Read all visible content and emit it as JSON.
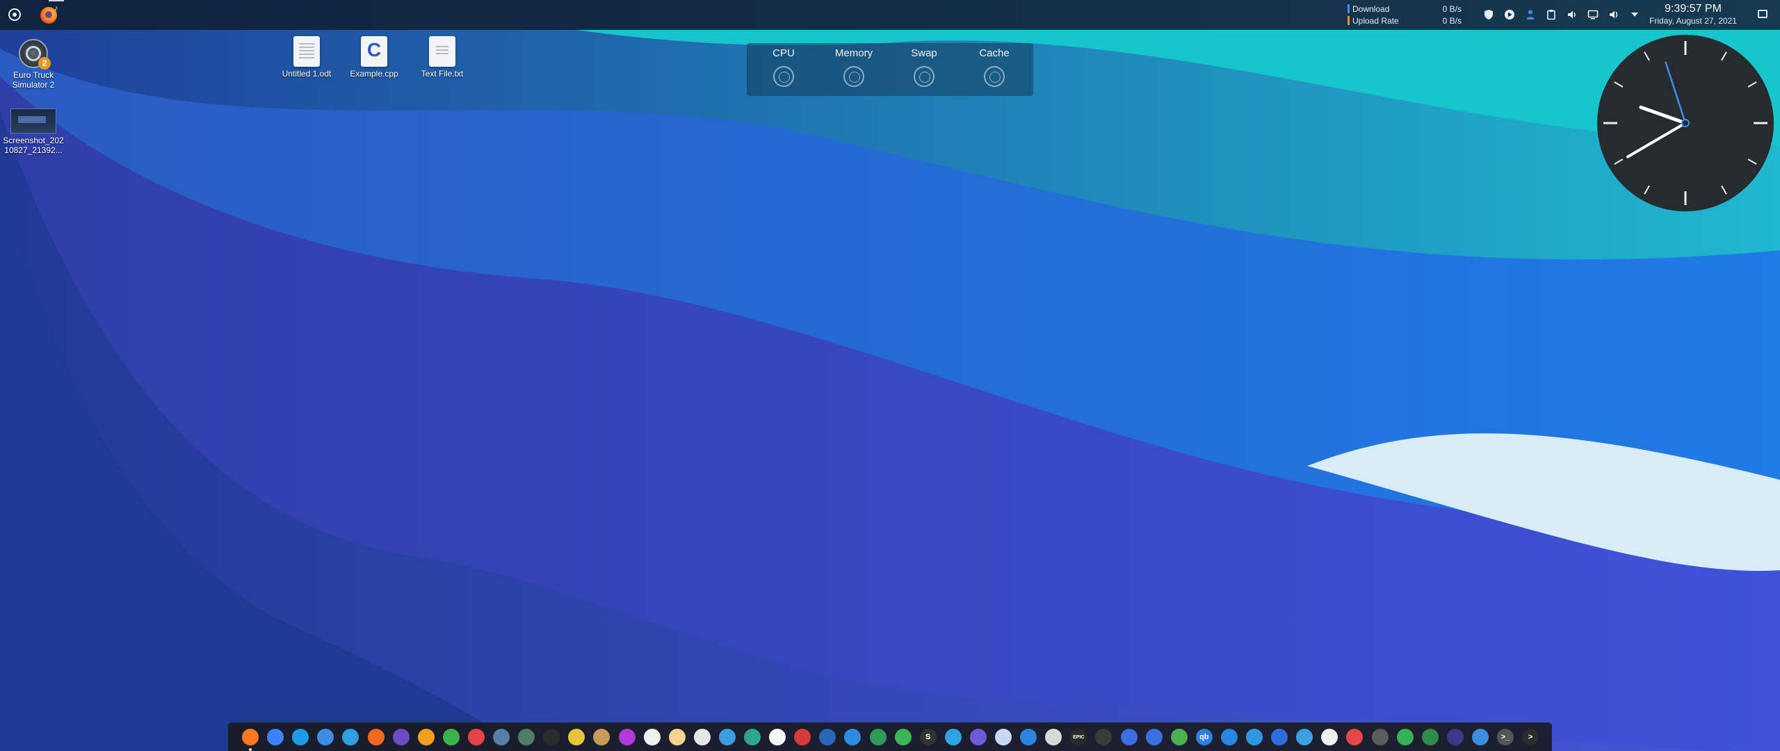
{
  "panel": {
    "network": {
      "download_label": "Download",
      "download_value": "0 B/s",
      "upload_label": "Upload Rate",
      "upload_value": "0 B/s",
      "download_color": "#3d8fe8",
      "upload_color": "#e8922a"
    },
    "tray_icons": [
      "shield-icon",
      "play-icon",
      "person-icon",
      "clipboard-icon",
      "volume-icon",
      "display-icon",
      "speaker-icon",
      "arrow-down-icon"
    ],
    "clock": {
      "time": "9:39:57 PM",
      "date": "Friday, August 27, 2021"
    }
  },
  "desktop_icons": [
    {
      "label": "Euro Truck Simulator 2",
      "badge": "2"
    },
    {
      "label": "Screenshot_20210827_21392..."
    },
    {
      "label": "Untitled 1.odt"
    },
    {
      "label": "Example.cpp",
      "glyph": "C"
    },
    {
      "label": "Text File.txt"
    }
  ],
  "system_monitor": {
    "items": [
      "CPU",
      "Memory",
      "Swap",
      "Cache"
    ]
  },
  "analog_clock": {
    "time": "9:39:57"
  },
  "dock": {
    "items": [
      {
        "name": "firefox-icon",
        "color": "#ff7a1f",
        "glyph": ""
      },
      {
        "name": "chromium-icon",
        "color": "#3b82f6",
        "glyph": ""
      },
      {
        "name": "kde-connect-icon",
        "color": "#1e9be8",
        "glyph": ""
      },
      {
        "name": "files-icon",
        "color": "#3d8de8",
        "glyph": ""
      },
      {
        "name": "mail-icon",
        "color": "#2e9fe0",
        "glyph": ""
      },
      {
        "name": "rss-icon",
        "color": "#f06a1e",
        "glyph": ""
      },
      {
        "name": "media-player-icon",
        "color": "#6e4ac4",
        "glyph": ""
      },
      {
        "name": "video-player-icon",
        "color": "#f2a01c",
        "glyph": ""
      },
      {
        "name": "play-green-icon",
        "color": "#3bb24a",
        "glyph": ""
      },
      {
        "name": "youtube-icon",
        "color": "#e8424a",
        "glyph": ""
      },
      {
        "name": "monitor-icon",
        "color": "#557ea8",
        "glyph": ""
      },
      {
        "name": "terminal-grid-icon",
        "color": "#4c7e6a",
        "glyph": ""
      },
      {
        "name": "vinyl-icon",
        "color": "#2c2c2c",
        "glyph": ""
      },
      {
        "name": "color-picker-icon",
        "color": "#e8c43c",
        "glyph": ""
      },
      {
        "name": "camera-icon",
        "color": "#c89b57",
        "glyph": ""
      },
      {
        "name": "gradient-icon",
        "color": "#b03ad8",
        "glyph": ""
      },
      {
        "name": "cat-icon",
        "color": "#f0f0f0",
        "glyph": ""
      },
      {
        "name": "paint-icon",
        "color": "#f2d48e",
        "glyph": ""
      },
      {
        "name": "disc-icon",
        "color": "#e6e6e6",
        "glyph": ""
      },
      {
        "name": "image-viewer-icon",
        "color": "#3a9de0",
        "glyph": ""
      },
      {
        "name": "photos-icon",
        "color": "#2ea58e",
        "glyph": ""
      },
      {
        "name": "timer-icon",
        "color": "#f5f5f5",
        "glyph": ""
      },
      {
        "name": "book-icon",
        "color": "#d63a3a",
        "glyph": ""
      },
      {
        "name": "krita-icon",
        "color": "#2a67b8",
        "glyph": ""
      },
      {
        "name": "vscode-icon",
        "color": "#2b8ce0",
        "glyph": ""
      },
      {
        "name": "android-studio-icon",
        "color": "#2e9b5a",
        "glyph": ""
      },
      {
        "name": "android-icon",
        "color": "#3bb554",
        "glyph": ""
      },
      {
        "name": "s-app-icon",
        "color": "#333333",
        "glyph": "S"
      },
      {
        "name": "cake-icon",
        "color": "#2da3e0",
        "glyph": ""
      },
      {
        "name": "mastodon-icon",
        "color": "#6d5ad8",
        "glyph": ""
      },
      {
        "name": "cloud-icon",
        "color": "#c7d8f4",
        "glyph": ""
      },
      {
        "name": "kdevelop-icon",
        "color": "#2d84e0",
        "glyph": ""
      },
      {
        "name": "target-icon",
        "color": "#d8d8d8",
        "glyph": ""
      },
      {
        "name": "epic-games-icon",
        "color": "#2a2a2a",
        "glyph": "EPIC"
      },
      {
        "name": "steam-like-icon",
        "color": "#3b3b3b",
        "glyph": ""
      },
      {
        "name": "moon-icon",
        "color": "#3a6fe0",
        "glyph": ""
      },
      {
        "name": "moon-alt-icon",
        "color": "#3a6fe0",
        "glyph": ""
      },
      {
        "name": "download-green-icon",
        "color": "#4caf50",
        "glyph": ""
      },
      {
        "name": "qbittorrent-icon",
        "color": "#2e7de0",
        "glyph": "qb"
      },
      {
        "name": "download-blue-icon",
        "color": "#2a85e0",
        "glyph": ""
      },
      {
        "name": "droplet-icon",
        "color": "#2f97e0",
        "glyph": ""
      },
      {
        "name": "phone-icon",
        "color": "#2e6de0",
        "glyph": ""
      },
      {
        "name": "recycle-icon",
        "color": "#3aa0e0",
        "glyph": ""
      },
      {
        "name": "brush-icon",
        "color": "#f0f0f0",
        "glyph": ""
      },
      {
        "name": "game-controller-icon",
        "color": "#e8474a",
        "glyph": ""
      },
      {
        "name": "ghost-icon",
        "color": "#5c5c5c",
        "glyph": ""
      },
      {
        "name": "shield-green-icon",
        "color": "#33b25a",
        "glyph": ""
      },
      {
        "name": "chip-icon",
        "color": "#2e8b4a",
        "glyph": ""
      },
      {
        "name": "activity-icon",
        "color": "#3a3a8c",
        "glyph": ""
      },
      {
        "name": "toggle-icon",
        "color": "#3a8ee0",
        "glyph": ""
      },
      {
        "name": "console-icon",
        "color": "#555555",
        "glyph": ">_"
      },
      {
        "name": "chevron-right-icon",
        "color": "#2b2b2b",
        "glyph": ">"
      }
    ]
  },
  "colors": {
    "panel_bg": "#11243f",
    "dock_bg": "#191b23",
    "clock_face": "#262b2f",
    "clock_second_hand": "#3d8fe8"
  }
}
